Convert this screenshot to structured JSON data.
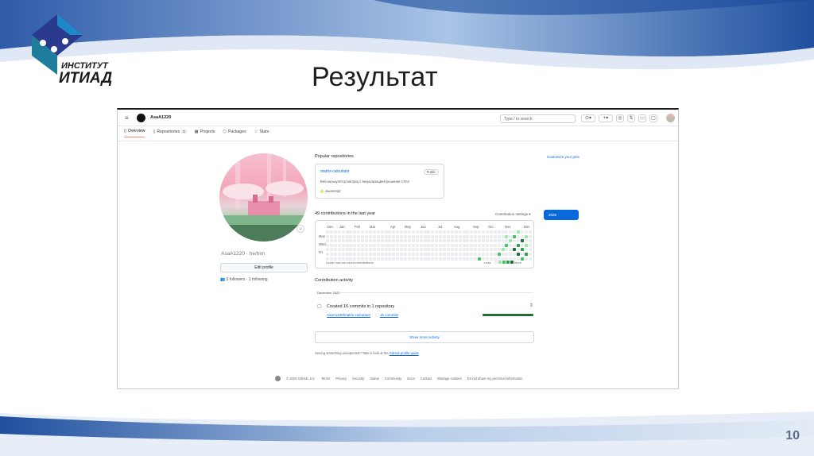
{
  "slide": {
    "title": "Результат",
    "page_number": "10",
    "logo": {
      "line1": "ИНСТИТУТ",
      "line2": "ИТИАД"
    }
  },
  "github": {
    "header": {
      "username": "AsaA1220",
      "search_placeholder": "Type / to search",
      "icons": [
        "menu-icon",
        "github-logo-icon",
        "copilot-icon",
        "plus-icon",
        "issues-icon",
        "pull-requests-icon",
        "inbox-icon",
        "notifications-icon",
        "avatar"
      ]
    },
    "tabs": [
      {
        "label": "Overview",
        "active": true
      },
      {
        "label": "Repositories",
        "count": "1"
      },
      {
        "label": "Projects"
      },
      {
        "label": "Packages"
      },
      {
        "label": "Stars"
      }
    ],
    "profile": {
      "name_line": "AsaA1220 · he/him",
      "edit_button": "Edit profile",
      "followers_text": "0 followers · 1 following",
      "followers_prefix": "",
      "emoji_icon": "☺"
    },
    "popular": {
      "title": "Popular repositories",
      "customize": "Customize your pins",
      "repo": {
        "name": "matrix-calculator",
        "visibility": "Public",
        "description": "Веб-калькулятор матриц с визуализацией решения СЛАУ",
        "language": "JavaScript",
        "language_color": "#f1e05a"
      }
    },
    "contributions": {
      "title": "49 contributions in the last year",
      "settings": "Contribution settings ▾",
      "year": "2025",
      "months": [
        "Dec",
        "Jan",
        "Feb",
        "Mar",
        "Apr",
        "May",
        "Jun",
        "Jul",
        "Aug",
        "Sep",
        "Oct",
        "Nov",
        "Dec"
      ],
      "days": [
        "Mon",
        "Wed",
        "Fri"
      ],
      "learn": "Learn how we count contributions",
      "legend_less": "Less",
      "legend_more": "More",
      "colors": [
        "#ebedf0",
        "#9be9a8",
        "#40c463",
        "#30a14e",
        "#216e39"
      ]
    },
    "activity": {
      "title": "Contribution activity",
      "month": "December 2025",
      "headline": "Created 16 commits in 1 repository",
      "repo_link": "AsaA1220/matrix-calculator",
      "commits": "16 commits",
      "show_more": "Show more activity",
      "unexpected_text": "Seeing something unexpected? Take a look at the",
      "unexpected_link": "GitHub profile guide"
    },
    "footer": [
      "© 2025 GitHub, Inc.",
      "Terms",
      "Privacy",
      "Security",
      "Status",
      "Community",
      "Docs",
      "Contact",
      "Manage cookies",
      "Do not share my personal information"
    ]
  }
}
